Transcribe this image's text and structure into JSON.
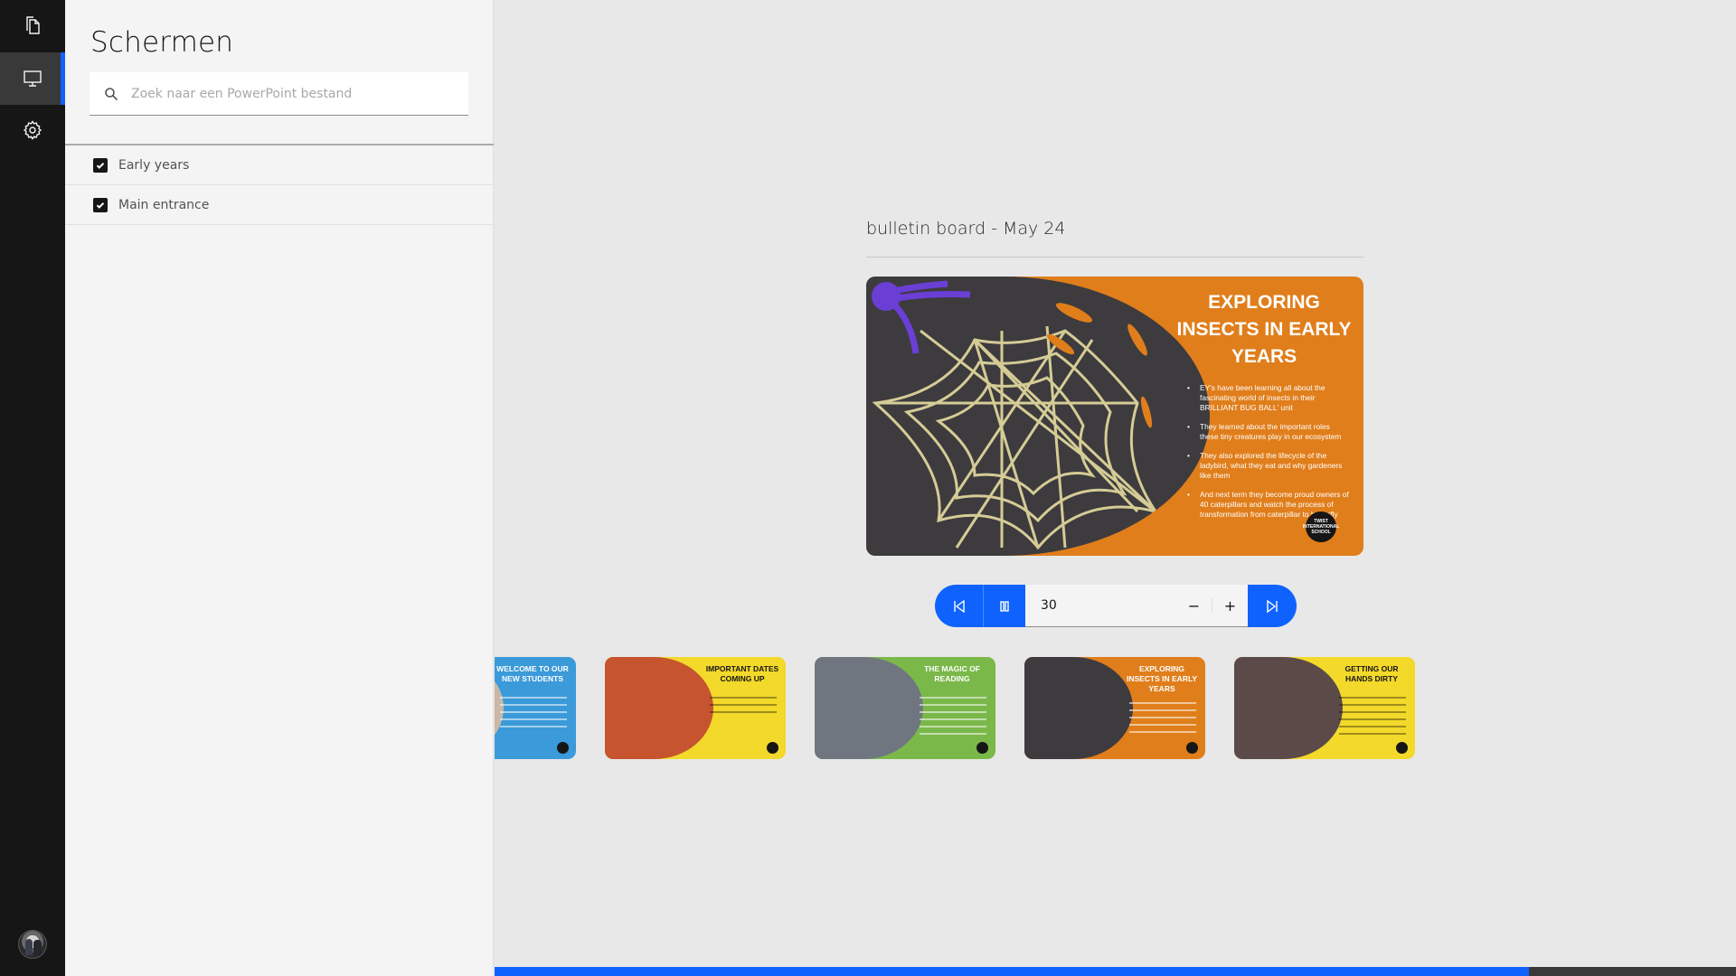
{
  "nav": {
    "items": [
      {
        "name": "documents",
        "icon": "copy-file-icon",
        "active": false
      },
      {
        "name": "screens",
        "icon": "monitor-icon",
        "active": true
      },
      {
        "name": "settings",
        "icon": "gear-icon",
        "active": false
      }
    ],
    "avatar": "user-avatar"
  },
  "panel": {
    "title": "Schermen",
    "search": {
      "placeholder": "Zoek naar een PowerPoint bestand",
      "value": ""
    },
    "screens": [
      {
        "label": "Early years",
        "checked": true
      },
      {
        "label": "Main entrance",
        "checked": true
      }
    ]
  },
  "main": {
    "presentation_title": "bulletin board - May 24",
    "current_slide": {
      "title": "EXPLORING INSECTS IN EARLY YEARS",
      "bullets": [
        "EY's have been learning all about the fascinating world of insects in their BRILLIANT BUG BALL' unit",
        "They learned about the important roles these tiny creatures play in our ecosystem",
        "They also explored the lifecycle of the ladybird, what they eat and why gardeners like them",
        "And next term they become proud owners of 40 caterpillars and watch the process of transformation from caterpillar to butterfly"
      ],
      "logo_text": "TWIST INTERNATIONAL SCHOOL",
      "accent": "#e07e1b"
    },
    "controls": {
      "prev_icon": "skip-back-icon",
      "pause_icon": "pause-icon",
      "next_icon": "skip-forward-icon",
      "interval_value": "30",
      "decrement_label": "−",
      "increment_label": "+"
    },
    "thumbnails": [
      {
        "title": "WELCOME TO OUR NEW STUDENTS",
        "color": "#3b9ad9",
        "photo": "#c9b8a8",
        "dark_text": false
      },
      {
        "title": "IMPORTANT DATES COMING UP",
        "color": "#f3d92a",
        "photo": "#c6542e",
        "dark_text": true
      },
      {
        "title": "THE MAGIC OF READING",
        "color": "#7bb84a",
        "photo": "#6f7680",
        "dark_text": false
      },
      {
        "title": "EXPLORING INSECTS IN EARLY YEARS",
        "color": "#e07e1b",
        "photo": "#3d3b3e",
        "dark_text": false,
        "current": true
      },
      {
        "title": "GETTING OUR HANDS DIRTY",
        "color": "#f3d92a",
        "photo": "#5b4a48",
        "dark_text": true
      }
    ],
    "progress": 0.833
  },
  "colors": {
    "accent": "#0f62fe",
    "rail": "#161616",
    "panel": "#f4f4f4",
    "background": "#e8e8e8"
  }
}
